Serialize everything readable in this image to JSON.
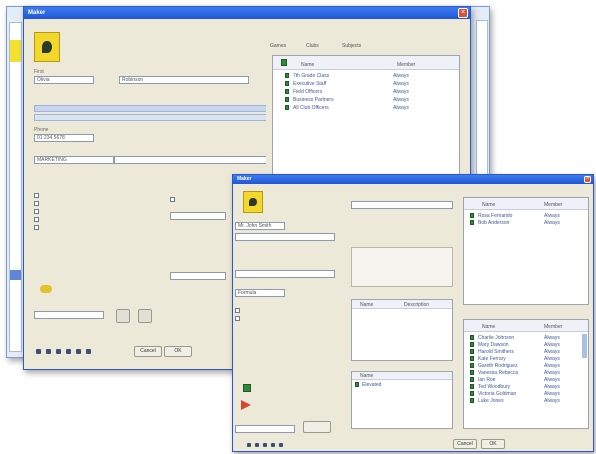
{
  "back_window": {
    "title": "Maker"
  },
  "front_window": {
    "title": "Maker"
  },
  "back_fields": {
    "first_name": "Olivia",
    "last_name": "Robinson",
    "phone": "01 234 5678",
    "group": "MARKETING"
  },
  "back_tabs": [
    "Games",
    "Clubs",
    "Subjects"
  ],
  "back_list": {
    "headers": [
      "Name",
      "Member"
    ],
    "rows": [
      {
        "name": "7th Grade Class",
        "member": "Always"
      },
      {
        "name": "Executive Staff",
        "member": "Always"
      },
      {
        "name": "Field Officers",
        "member": "Always"
      },
      {
        "name": "Business Partners",
        "member": "Always"
      },
      {
        "name": "All Club Officers",
        "member": "Always"
      }
    ]
  },
  "back_actions": {
    "cancel": "Cancel",
    "ok": "OK"
  },
  "front_fields": {
    "name": "Mr. John Smith",
    "combo": "Formula"
  },
  "front_lists": {
    "top_headers": [
      "Name",
      "Member"
    ],
    "top_rows": [
      {
        "name": "Rosa Fernando",
        "member": "Always"
      },
      {
        "name": "Bob Anderson",
        "member": "Always"
      }
    ],
    "middle_headers": [
      "Name",
      "Description"
    ],
    "bottom_headers": [
      "Name",
      "Member"
    ],
    "bottom_rows": [
      {
        "name": "Charlie Johnson",
        "member": "Always"
      },
      {
        "name": "Mary Dawson",
        "member": "Always"
      },
      {
        "name": "Harold Smithers",
        "member": "Always"
      },
      {
        "name": "Kate Ferrary",
        "member": "Always"
      },
      {
        "name": "Gareth Rodriguez",
        "member": "Always"
      },
      {
        "name": "Vanessa Rebecca",
        "member": "Always"
      },
      {
        "name": "Ian Roe",
        "member": "Always"
      },
      {
        "name": "Ted Woodbury",
        "member": "Always"
      },
      {
        "name": "Victoria Goldman",
        "member": "Always"
      },
      {
        "name": "Luke Jones",
        "member": "Always"
      }
    ],
    "small_list_header": "Name",
    "small_list_item": "Elevated"
  },
  "front_actions": {
    "cancel": "Cancel",
    "ok": "OK"
  }
}
